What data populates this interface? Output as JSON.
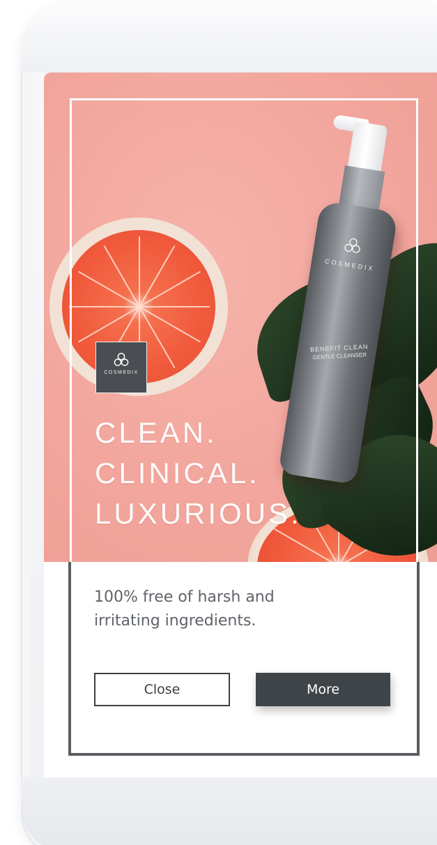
{
  "ad": {
    "brand": "COSMEDIX",
    "headline": [
      "CLEAN.",
      "CLINICAL.",
      "LUXURIOUS."
    ],
    "body": "100% free of harsh and irritating ingredients.",
    "body_lines": [
      "100% free of harsh and",
      "irritating ingredients."
    ],
    "product": {
      "name": "BENEFIT CLEAN",
      "subname": "GENTLE CLEANSER"
    }
  },
  "buttons": {
    "close_label": "Close",
    "more_label": "More"
  },
  "colors": {
    "background_pink": "#f2a69d",
    "button_dark": "#3f4448",
    "text_gray": "#5f6368",
    "frame_dark": "#5a5d61"
  },
  "icons": {
    "brand_logo": "cosmedix-logo-icon"
  }
}
